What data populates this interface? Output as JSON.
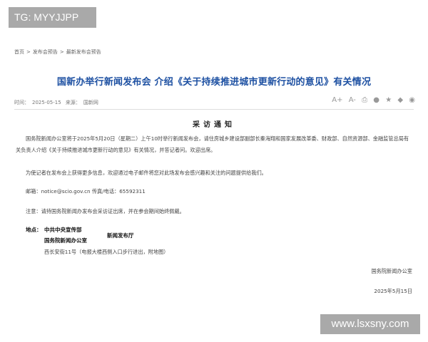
{
  "watermarks": {
    "top": "TG: MYYJJPP",
    "bottom": "www.lsxsny.com"
  },
  "breadcrumb": {
    "items": [
      "首页",
      "发布会预告",
      "最新发布会预告"
    ],
    "separator": ">"
  },
  "title": "国新办举行新闻发布会 介绍《关于持续推进城市更新行动的意见》有关情况",
  "meta": {
    "time_label": "时间：",
    "time": "2025-05-15",
    "source_label": "来源：",
    "source": "国新网"
  },
  "tools": {
    "font_larger": "A+",
    "font_smaller": "A-",
    "print": "⎙",
    "share": [
      "●",
      "★",
      "◆",
      "◉"
    ]
  },
  "notice": {
    "heading": "采访通知",
    "paragraph1": "国务院新闻办公室将于2025年5月20日（星期二）上午10时举行新闻发布会，请住房城乡建设部副部长秦海翔和国家发展改革委、财政部、自然资源部、金融监管总局有关负责人介绍《关于持续推进城市更新行动的意见》有关情况，并答记者问。欢迎出席。",
    "paragraph2": "为使记者在发布会上获得更多信息，欢迎通过电子邮件将您对此场发布会感兴趣和关注的问题提供给我们。",
    "contact": "邮箱：notice@scio.gov.cn 传真/电话：65592311",
    "note": "注意：请持国务院新闻办发布会采访证出席，并在参会期间始终佩戴。",
    "location_label": "地点：",
    "org1": "中共中央宣传部",
    "org2": "国务院新闻办公室",
    "hall": "新闻发布厅",
    "address": "西长安街11号（电报大楼西侧入口步行进出，附地图）",
    "signature": "国务院新闻办公室",
    "date": "2025年5月15日"
  }
}
